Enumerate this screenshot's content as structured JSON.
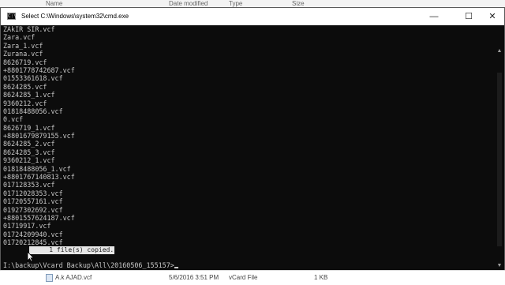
{
  "explorer": {
    "columns": [
      "Name",
      "Date modified",
      "Type",
      "Size"
    ],
    "footer_row": {
      "name": "A.k AJAD.vcf",
      "date": "5/6/2016 3:51 PM",
      "type": "vCard File",
      "size": "1 KB"
    }
  },
  "cmd": {
    "title": "Select C:\\Windows\\system32\\cmd.exe",
    "icon_label": "C:\\",
    "controls": {
      "minimize": "—",
      "maximize": "☐",
      "close": "✕"
    },
    "lines": [
      "ZAkIR SIR.vcf",
      "Zara.vcf",
      "Zara_1.vcf",
      "Zurana.vcf",
      "8626719.vcf",
      "+8801778742687.vcf",
      "01553361618.vcf",
      "8624285.vcf",
      "8624285_1.vcf",
      "9360212.vcf",
      "01818488056.vcf",
      "0.vcf",
      "8626719_1.vcf",
      "+8801679879155.vcf",
      "8624285_2.vcf",
      "8624285_3.vcf",
      "9360212_1.vcf",
      "01818488056_1.vcf",
      "+8801767140813.vcf",
      "017128353.vcf",
      "01712028353.vcf",
      "01720557161.vcf",
      "01927302692.vcf",
      "+8801557624187.vcf",
      "01719917.vcf",
      "01724209940.vcf",
      "01720212845.vcf"
    ],
    "copied_message": "    1 file(s) copied.",
    "prompt": "I:\\backup\\Vcard Backup\\All\\20160506_155157>"
  },
  "icons": {
    "app": "cmd-icon",
    "pointer": "mouse-pointer-icon",
    "scroll_up": "scroll-up-arrow-icon",
    "scroll_down": "scroll-down-arrow-icon"
  }
}
